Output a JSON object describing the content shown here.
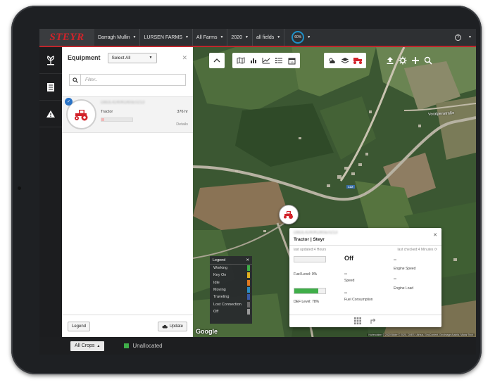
{
  "topbar": {
    "brand": "STEYR",
    "user": "Darragh Mullin",
    "farm": "LURSEN FARMS",
    "fields_scope": "All Farms",
    "year": "2020",
    "fields": "all fields",
    "progress_percent": "60%"
  },
  "panel": {
    "title": "Equipment",
    "select_label": "Select All",
    "filter_placeholder": "Filter..",
    "equipment": {
      "serial": "DBDL4240KD6SE0213",
      "type": "Tractor",
      "hours": "376 hr",
      "details": "Details",
      "fuel_fraction": 0.1
    },
    "legend_button": "Legend",
    "update_button": "Update"
  },
  "popup": {
    "serial": "DBDL4240KD6SE0213",
    "title": "Tractor | Steyr",
    "last_updated": "last updated:4 Hours",
    "last_checked": "last checked:4 Minutes",
    "status": "Off",
    "fuel_label": "Fuel Level: 0%",
    "fuel_fraction": 0.0,
    "def_label": "DEF Level: 78%",
    "def_fraction": 0.78,
    "speed_value": "--",
    "speed_label": "Speed",
    "fuel_consumption_value": "--",
    "fuel_consumption_label": "Fuel Consumption",
    "engine_speed_value": "--",
    "engine_speed_label": "Engine Speed",
    "engine_load_value": "--",
    "engine_load_label": "Engine Load"
  },
  "legend": {
    "title": "Legend",
    "items": [
      {
        "label": "Working",
        "color": "#3fae49"
      },
      {
        "label": "Key On",
        "color": "#e0b020"
      },
      {
        "label": "Idle",
        "color": "#e07a20"
      },
      {
        "label": "Moving",
        "color": "#2b8cc4"
      },
      {
        "label": "Traveling",
        "color": "#3a5aa8"
      },
      {
        "label": "Lost Connection",
        "color": "#6b6b6b"
      },
      {
        "label": "Off",
        "color": "#9a9a9a"
      }
    ]
  },
  "map": {
    "road_label": "Voralpenstraße",
    "road_number": "122",
    "google": "Google",
    "attribution": "Kartendaten © 2020 Bilder © 2020, CNES / Airbus, GeoContent, GeoImage Austria, Maxar Tech"
  },
  "bottombar": {
    "crops_button": "All Crops",
    "unallocated": "Unallocated"
  },
  "colors": {
    "brand_red": "#d2232a",
    "accent_blue": "#1e90c8",
    "unallocated_green": "#3fae49"
  }
}
